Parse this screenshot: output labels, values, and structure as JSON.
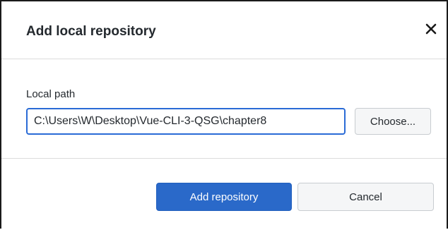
{
  "dialog": {
    "title": "Add local repository",
    "close_icon": "close-icon"
  },
  "form": {
    "local_path_label": "Local path",
    "local_path_value": "C:\\Users\\W\\Desktop\\Vue-CLI-3-QSG\\chapter8",
    "choose_label": "Choose..."
  },
  "footer": {
    "primary_label": "Add repository",
    "cancel_label": "Cancel"
  },
  "colors": {
    "primary": "#2a69c9",
    "focus_border": "#2a6bd6",
    "divider": "#dcdcdc"
  }
}
